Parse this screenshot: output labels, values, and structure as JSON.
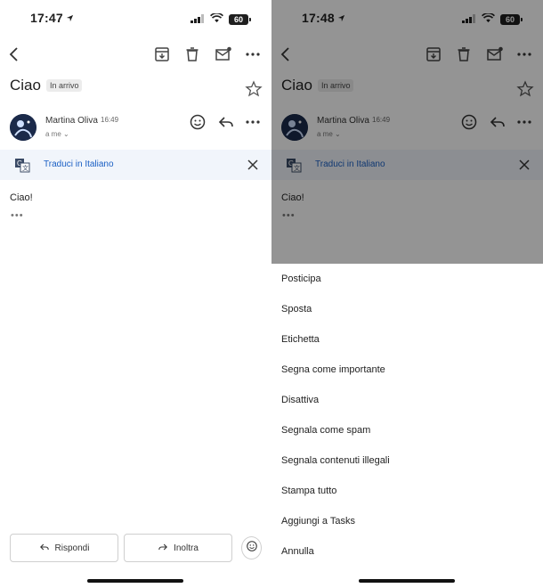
{
  "left": {
    "status_time": "17:47",
    "battery": "60",
    "subject": "Ciao",
    "label_chip": "In arrivo",
    "sender_name": "Martina Oliva",
    "sender_time": "16:49",
    "recipient": "a me",
    "translate_label": "Traduci in Italiano",
    "body_text": "Ciao!",
    "reply_label": "Rispondi",
    "forward_label": "Inoltra"
  },
  "right": {
    "status_time": "17:48",
    "battery": "60",
    "subject": "Ciao",
    "label_chip": "In arrivo",
    "sender_name": "Martina Oliva",
    "sender_time": "16:49",
    "recipient": "a me",
    "translate_label": "Traduci in Italiano",
    "body_text": "Ciao!",
    "menu": [
      "Posticipa",
      "Sposta",
      "Etichetta",
      "Segna come importante",
      "Disattiva",
      "Segnala come spam",
      "Segnala contenuti illegali",
      "Stampa tutto",
      "Aggiungi a Tasks",
      "Annulla"
    ]
  },
  "icons": [
    "back-icon",
    "archive-icon",
    "delete-icon",
    "mark-unread-icon",
    "more-icon",
    "star-icon",
    "emoji-icon",
    "reply-icon",
    "translate-icon",
    "close-icon",
    "forward-icon"
  ],
  "colors": {
    "link_blue": "#1a5fc4",
    "translate_bg": "#f1f5fb",
    "overlay": "rgba(0,0,0,0.42)"
  }
}
